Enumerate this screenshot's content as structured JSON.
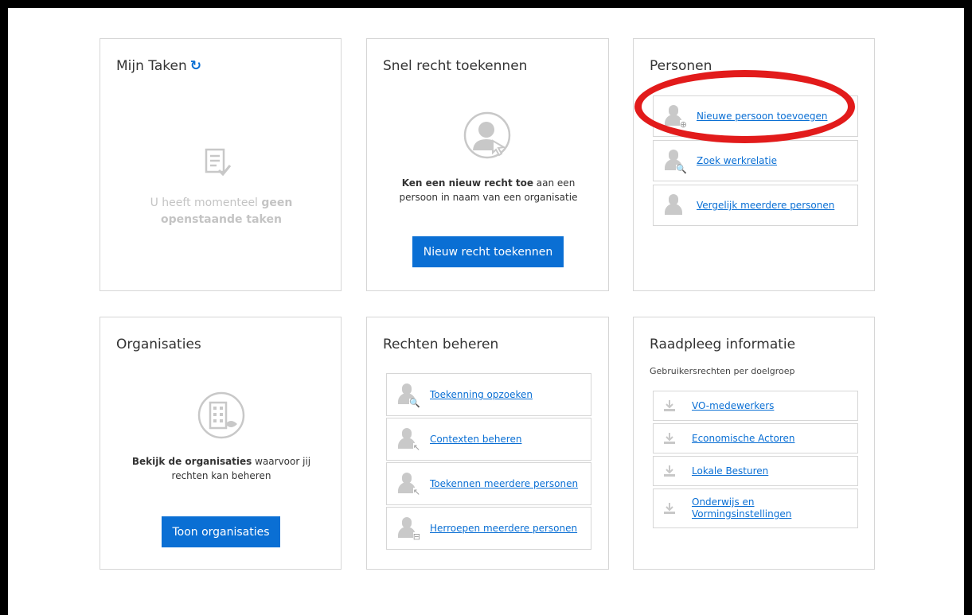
{
  "taken": {
    "title": "Mijn Taken",
    "refresh_icon": "↻",
    "empty_text_1": "U heeft momenteel ",
    "empty_bold_1": "geen",
    "empty_bold_2": "openstaande taken"
  },
  "snel": {
    "title": "Snel recht toekennen",
    "desc_bold": "Ken een nieuw recht toe",
    "desc_rest_1": " aan een",
    "desc_line2": "persoon in naam van een organisatie",
    "button": "Nieuw recht toekennen"
  },
  "personen": {
    "title": "Personen",
    "items": [
      {
        "label": "Nieuwe persoon toevoegen",
        "icon": "person-add-icon"
      },
      {
        "label": "Zoek werkrelatie",
        "icon": "person-search-icon"
      },
      {
        "label": "Vergelijk meerdere personen",
        "icon": "person-compare-icon"
      }
    ]
  },
  "organisaties": {
    "title": "Organisaties",
    "desc_bold_1": "Bekijk de organisaties",
    "desc_rest_1": " waarvoor jij",
    "desc_line2": "rechten kan beheren",
    "button": "Toon organisaties"
  },
  "rechten": {
    "title": "Rechten beheren",
    "items": [
      {
        "label": "Toekenning opzoeken",
        "icon": "person-search-icon"
      },
      {
        "label": "Contexten beheren",
        "icon": "person-cursor-icon"
      },
      {
        "label": "Toekennen meerdere personen",
        "icon": "person-cursor-icon"
      },
      {
        "label": "Herroepen meerdere personen",
        "icon": "person-revoke-icon"
      }
    ]
  },
  "raadpleeg": {
    "title": "Raadpleeg informatie",
    "subtitle": "Gebruikersrechten per doelgroep",
    "items": [
      {
        "label": "VO-medewerkers"
      },
      {
        "label": "Economische Actoren"
      },
      {
        "label": "Lokale Besturen"
      },
      {
        "label_1": "Onderwijs en",
        "label_2": "Vormingsinstellingen"
      }
    ]
  },
  "colors": {
    "accent": "#0a6fd4",
    "highlight": "#e21b1b",
    "border": "#d6d6d6"
  }
}
